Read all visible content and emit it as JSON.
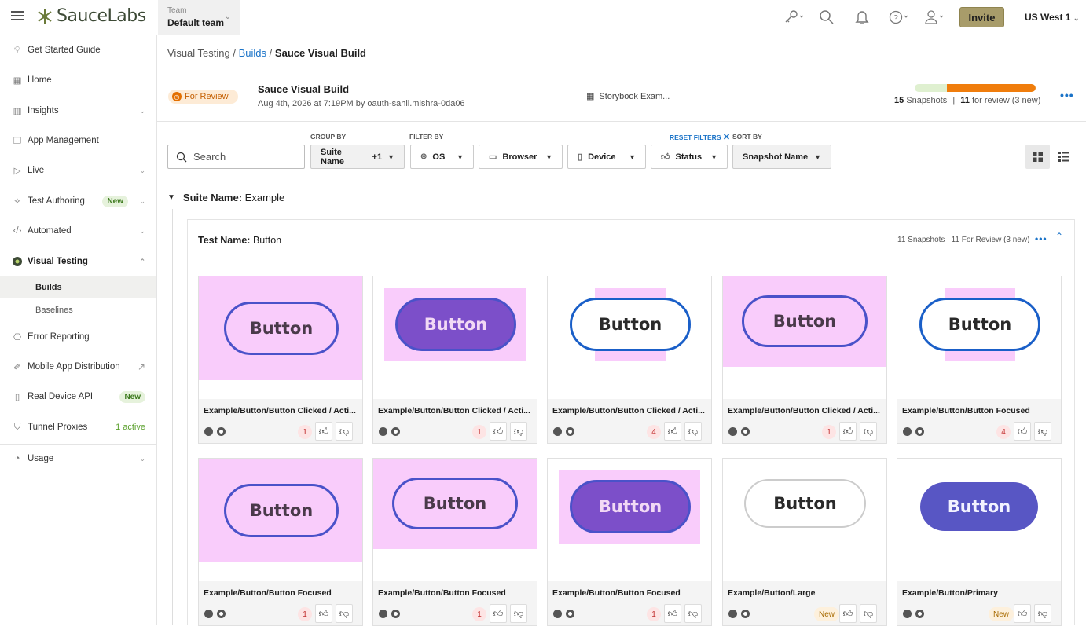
{
  "app": {
    "logo": "SauceLabs"
  },
  "team": {
    "label": "Team",
    "value": "Default team"
  },
  "topbar": {
    "invite_label": "Invite",
    "region": "US West 1"
  },
  "sidebar": {
    "items": [
      {
        "label": "Get Started Guide",
        "icon": "lightbulb-icon"
      },
      {
        "label": "Home",
        "icon": "home-icon"
      },
      {
        "label": "Insights",
        "icon": "chart-icon"
      },
      {
        "label": "App Management",
        "icon": "app-icon"
      },
      {
        "label": "Live",
        "icon": "play-icon"
      },
      {
        "label": "Test Authoring",
        "icon": "wand-icon",
        "badge": "New"
      },
      {
        "label": "Automated",
        "icon": "code-icon"
      },
      {
        "label": "Visual Testing",
        "icon": "eye-icon"
      },
      {
        "label": "Error Reporting",
        "icon": "bug-icon"
      },
      {
        "label": "Mobile App Distribution",
        "icon": "mobile-icon"
      },
      {
        "label": "Real Device API",
        "icon": "device-icon",
        "badge": "New"
      },
      {
        "label": "Tunnel Proxies",
        "icon": "shield-icon",
        "status": "1 active"
      },
      {
        "label": "Usage",
        "icon": "gauge-icon"
      }
    ],
    "sub_items": [
      {
        "label": "Builds"
      },
      {
        "label": "Baselines"
      }
    ]
  },
  "breadcrumb": {
    "root": "Visual Testing",
    "sep1": "/",
    "link": "Builds",
    "sep2": "/",
    "current": "Sauce Visual Build"
  },
  "build": {
    "status": "For Review",
    "name": "Sauce Visual Build",
    "meta": "Aug 4th, 2026 at 7:19PM by oauth-sahil.mishra-0da06",
    "project": "Storybook Exam...",
    "snapshots_count": "15",
    "snapshots_label": "Snapshots",
    "separator": "|",
    "review_count": "11",
    "review_label": "for review (3 new)",
    "review_fraction": 0.733
  },
  "filters": {
    "group_by_label": "GROUP BY",
    "filter_by_label": "FILTER BY",
    "reset_label": "RESET FILTERS",
    "sort_by_label": "SORT BY",
    "search_placeholder": "Search",
    "group_by": "Suite Name",
    "group_by_extra": "+1",
    "os": "OS",
    "browser": "Browser",
    "device": "Device",
    "status": "Status",
    "sort": "Snapshot Name"
  },
  "suite": {
    "label": "Suite Name:",
    "value": "Example"
  },
  "test": {
    "label": "Test Name:",
    "value": "Button",
    "info": "11 Snapshots | 11 For Review (3 new)"
  },
  "snapshots": [
    {
      "title": "Example/Button/Button Clicked / Acti...",
      "count": "1"
    },
    {
      "title": "Example/Button/Button Clicked / Acti...",
      "count": "1"
    },
    {
      "title": "Example/Button/Button Clicked / Acti...",
      "count": "4"
    },
    {
      "title": "Example/Button/Button Clicked / Acti...",
      "count": "1"
    },
    {
      "title": "Example/Button/Button Focused",
      "count": "4"
    },
    {
      "title": "Example/Button/Button Focused",
      "count": "1"
    },
    {
      "title": "Example/Button/Button Focused",
      "count": "1"
    },
    {
      "title": "Example/Button/Button Focused",
      "count": "1"
    },
    {
      "title": "Example/Button/Large",
      "count": "New"
    },
    {
      "title": "Example/Button/Primary",
      "count": "New"
    }
  ],
  "thumb_text": "Button",
  "colors": {
    "accent": "#1a73c8",
    "review_orange": "#f07d0c",
    "approved_green": "#dff0d0",
    "invite": "#a89c6a",
    "thumb_pink": "#f9ccfb",
    "thumb_purple": "#7c4fc9"
  }
}
